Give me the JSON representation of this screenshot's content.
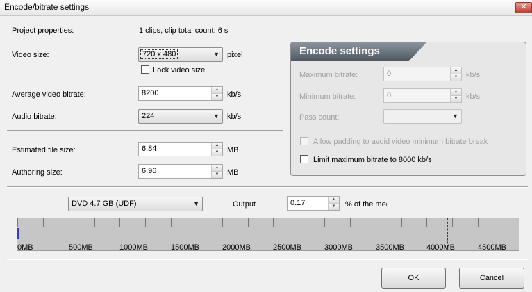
{
  "window": {
    "title": "Encode/bitrate settings",
    "close_glyph": "✕"
  },
  "project": {
    "label": "Project properties:",
    "value": "1 clips,  clip total count: 6 s"
  },
  "video_size": {
    "label": "Video size:",
    "value": "720 x 480",
    "unit": "pixel"
  },
  "lock_video_size": {
    "label": "Lock video size",
    "checked": false
  },
  "avg_bitrate": {
    "label": "Average video bitrate:",
    "value": "8200",
    "unit": "kb/s"
  },
  "audio_bitrate": {
    "label": "Audio bitrate:",
    "value": "224",
    "unit": "kb/s"
  },
  "est_file_size": {
    "label": "Estimated file size:",
    "value": "6.84",
    "unit": "MB"
  },
  "authoring_size": {
    "label": "Authoring size:",
    "value": "6.96",
    "unit": "MB"
  },
  "encode": {
    "title": "Encode settings",
    "max_bitrate": {
      "label": "Maximum bitrate:",
      "value": "0",
      "unit": "kb/s"
    },
    "min_bitrate": {
      "label": "Minimum bitrate:",
      "value": "0",
      "unit": "kb/s"
    },
    "pass_count": {
      "label": "Pass count:",
      "value": ""
    },
    "allow_padding": {
      "label": "Allow padding to avoid video minimum bitrate break",
      "checked": false,
      "enabled": false
    },
    "limit_max": {
      "label": "Limit maximum bitrate to 8000 kb/s",
      "checked": false,
      "enabled": true
    }
  },
  "media": {
    "value": "DVD 4.7 GB (UDF)"
  },
  "output": {
    "label": "Output",
    "value": "0.17",
    "unit": "% of the media ca"
  },
  "gauge": {
    "labels": [
      "0MB",
      "500MB",
      "1000MB",
      "1500MB",
      "2000MB",
      "2500MB",
      "3000MB",
      "3500MB",
      "4000MB",
      "4500MB"
    ],
    "max_mb": 4900,
    "used_mb": 6.96,
    "limit_mb": 4200,
    "fill_color": "#2b3fbf",
    "limit_color": "#c00000"
  },
  "buttons": {
    "ok": "OK",
    "cancel": "Cancel"
  },
  "icons": {
    "dropdown": "▼",
    "spin_up": "▲",
    "spin_down": "▼"
  }
}
